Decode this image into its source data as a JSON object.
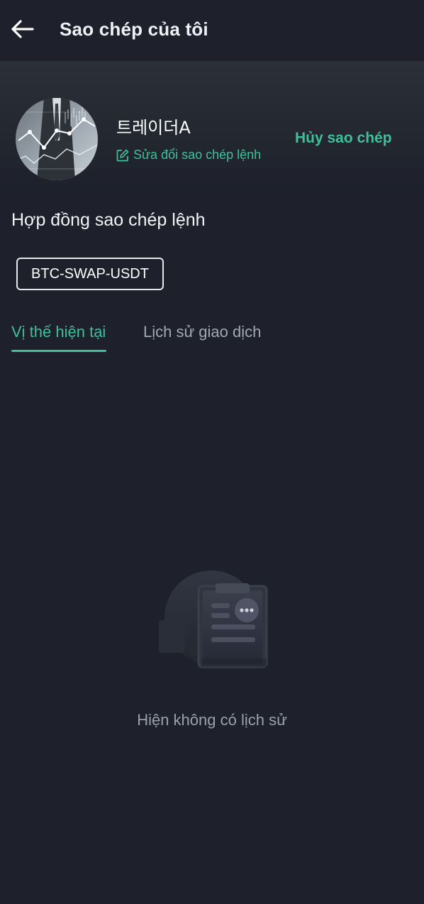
{
  "header": {
    "title": "Sao chép của tôi",
    "back_icon": "arrow-left-icon"
  },
  "trader": {
    "name": "트레이더A",
    "edit_label": "Sửa đổi sao chép lệnh",
    "edit_icon": "edit-icon",
    "cancel_label": "Hủy sao chép"
  },
  "contracts": {
    "label": "Hợp đồng sao chép lệnh",
    "items": [
      "BTC-SWAP-USDT"
    ]
  },
  "tabs": [
    {
      "label": "Vị thế hiện tại",
      "active": true
    },
    {
      "label": "Lịch sử giao dịch",
      "active": false
    }
  ],
  "empty_state": {
    "icon": "empty-clipboard-icon",
    "text": "Hiện không có lịch sử"
  },
  "colors": {
    "background": "#1e212b",
    "accent": "#3fbf9a",
    "muted_text": "#a2a8b3"
  }
}
